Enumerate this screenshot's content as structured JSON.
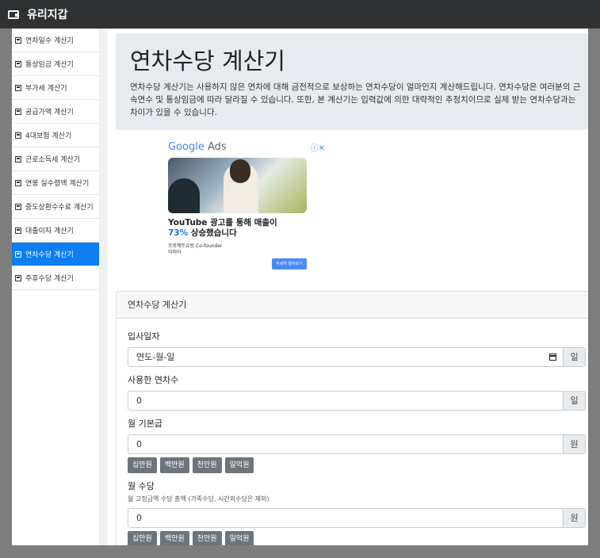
{
  "app": {
    "title": "유리지갑",
    "icon": "wallet-icon"
  },
  "sidebar": {
    "items": [
      {
        "label": "연차일수 계산기",
        "icon": "calculator-icon",
        "active": false
      },
      {
        "label": "통상임금 계산기",
        "icon": "calculator-icon",
        "active": false
      },
      {
        "label": "부가세 계산기",
        "icon": "calculator-icon",
        "active": false
      },
      {
        "label": "공급가액 계산기",
        "icon": "calculator-icon",
        "active": false
      },
      {
        "label": "4대보험 계산기",
        "icon": "calculator-icon",
        "active": false
      },
      {
        "label": "근로소득세 계산기",
        "icon": "calculator-icon",
        "active": false
      },
      {
        "label": "연봉 실수령액 계산기",
        "icon": "calculator-icon",
        "active": false
      },
      {
        "label": "중도상환수수료 계산기",
        "icon": "calculator-icon",
        "active": false
      },
      {
        "label": "대출이자 계산기",
        "icon": "calculator-icon",
        "active": false
      },
      {
        "label": "연차수당 계산기",
        "icon": "calculator-icon",
        "active": true
      },
      {
        "label": "주휴수당 계산기",
        "icon": "calculator-icon",
        "active": false
      }
    ]
  },
  "jumbotron": {
    "title": "연차수당 계산기",
    "description": "연차수당 계산기는 사용하지 않은 연차에 대해 금전적으로 보상하는 연차수당이 얼마인지 계산해드립니다. 연차수당은 여러분의 근속연수 및 통상임금에 따라 달라질 수 있습니다. 또한, 본 계산기는 입력값에 의한 대략적인 추정치이므로 실제 받는 연차수당과는 차이가 있을 수 있습니다."
  },
  "ad": {
    "brand": "Google",
    "brand_suffix": " Ads",
    "headline_1": "YouTube 광고를 통해 매출이",
    "headline_pct": "73%",
    "headline_2": " 상승했습니다",
    "meta_1": "프로젝트슈링 Co-founder",
    "meta_2": "이미아",
    "cta": "자세히 알아보기"
  },
  "card": {
    "title": "연차수당 계산기",
    "fields": {
      "join_date": {
        "label": "입사일자",
        "value": "연도-월-일",
        "unit": "일"
      },
      "used_leave": {
        "label": "사용한 연차수",
        "value": "0",
        "unit": "일"
      },
      "base_salary": {
        "label": "월 기본급",
        "value": "0",
        "unit": "원"
      },
      "allowance": {
        "label": "월 수당",
        "hint": "월 고정금액 수당 총액 (가족수당, 시간외수당은 제외)",
        "value": "0",
        "unit": "원"
      }
    },
    "quick_buttons": [
      "십만원",
      "백만원",
      "천만원",
      "일억원"
    ]
  }
}
